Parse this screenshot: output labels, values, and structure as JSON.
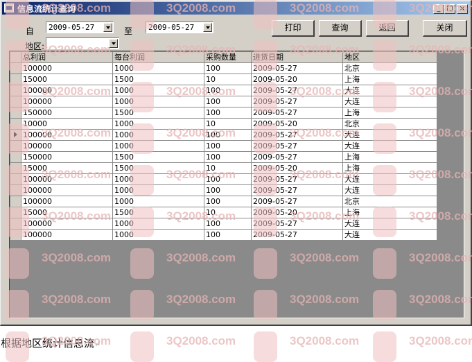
{
  "window": {
    "title": "信息流统计查询",
    "minimize": "_",
    "maximize": "□",
    "close": "×"
  },
  "filters": {
    "from_label": "自",
    "from_date": "2009-05-27",
    "to_label": "至",
    "to_date": "2009-05-27",
    "region_label": "地区:",
    "region_value": ""
  },
  "buttons": {
    "print": "打印",
    "query": "查询",
    "back": "返回",
    "close": "关闭"
  },
  "table": {
    "columns": [
      "总利润",
      "每台利润",
      "采购数量",
      "进货日期",
      "地区"
    ],
    "selected_row": 6,
    "rows": [
      [
        "100000",
        "1000",
        "100",
        "2009-05-27",
        "北京"
      ],
      [
        "15000",
        "1500",
        "10",
        "2009-05-20",
        "上海"
      ],
      [
        "100000",
        "1000",
        "100",
        "2009-05-27",
        "大连"
      ],
      [
        "100000",
        "1000",
        "100",
        "2009-05-27",
        "大连"
      ],
      [
        "150000",
        "1500",
        "100",
        "2009-05-27",
        "上海"
      ],
      [
        "10000",
        "1000",
        "10",
        "2009-05-20",
        "北京"
      ],
      [
        "100000",
        "1000",
        "100",
        "2009-05-27",
        "大连"
      ],
      [
        "100000",
        "1000",
        "100",
        "2009-05-27",
        "大连"
      ],
      [
        "150000",
        "1500",
        "100",
        "2009-05-27",
        "上海"
      ],
      [
        "15000",
        "1500",
        "10",
        "2009-05-20",
        "上海"
      ],
      [
        "100000",
        "1000",
        "100",
        "2009-05-27",
        "大连"
      ],
      [
        "100000",
        "1000",
        "100",
        "2009-05-27",
        "大连"
      ],
      [
        "100000",
        "1000",
        "100",
        "2009-05-27",
        "北京"
      ],
      [
        "15000",
        "1500",
        "10",
        "2009-05-20",
        "上海"
      ],
      [
        "100000",
        "1000",
        "100",
        "2009-05-27",
        "大连"
      ],
      [
        "100000",
        "1000",
        "100",
        "2009-05-27",
        "大连"
      ]
    ]
  },
  "caption": {
    "text": "根据地区统计信息流",
    "mark": "↵"
  },
  "watermark": {
    "text": "3Q2008.com"
  },
  "colors": {
    "titlebar_start": "#0a246a",
    "titlebar_end": "#a6caf0",
    "face": "#d4d0c8",
    "grid_bg": "#8a8a8a"
  }
}
